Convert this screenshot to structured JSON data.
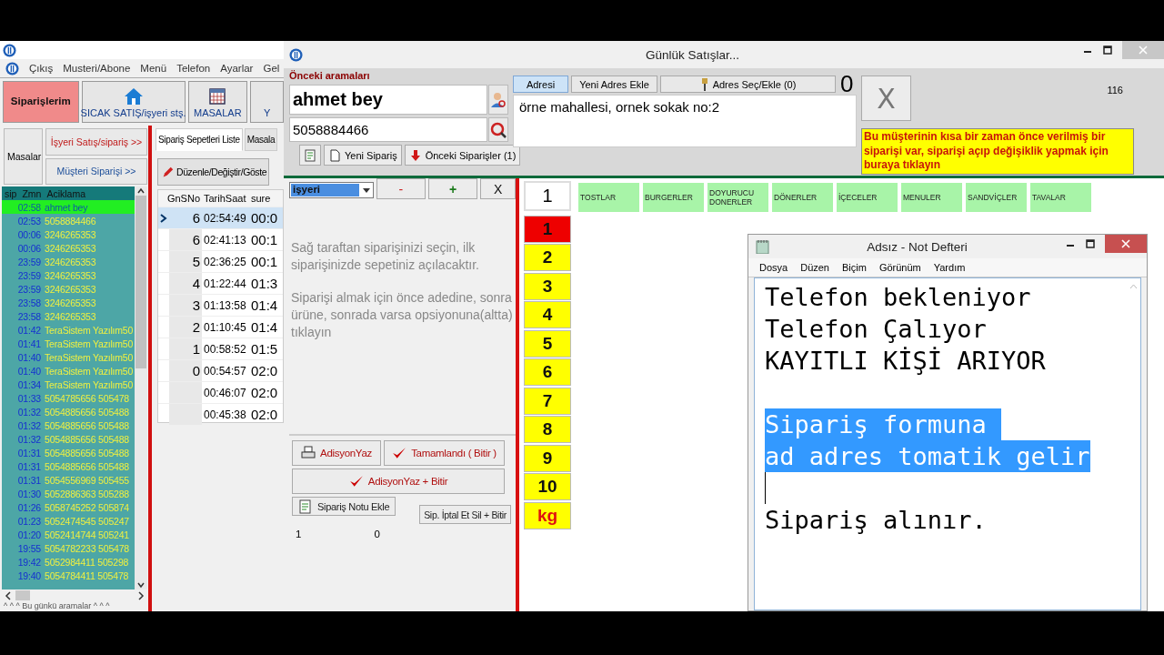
{
  "main_window": {
    "menu": [
      "Çıkış",
      "Musteri/Abone",
      "Menü",
      "Telefon",
      "Ayarlar",
      "Gel"
    ],
    "toolbar": [
      {
        "label": "Siparişlerim",
        "selected": true
      },
      {
        "label": "SICAK SATIŞ/işyeri stş.",
        "selected": false
      },
      {
        "label": "MASALAR",
        "selected": false
      },
      {
        "label": "Y",
        "selected": false
      }
    ],
    "side_buttons": [
      "Masalar",
      "İşyeri Satış/sipariş >>",
      "Müşteri Siparişi >>"
    ],
    "calls": {
      "columns": [
        "sip",
        "Zmn",
        "Aciklama"
      ],
      "rows": [
        {
          "time": "02:58",
          "description": "ahmet bey",
          "selected": true
        },
        {
          "time": "02:53",
          "description": "5058884466",
          "selected": false
        },
        {
          "time": "00:06",
          "description": "3246265353",
          "selected": false
        },
        {
          "time": "00:06",
          "description": "3246265353",
          "selected": false
        },
        {
          "time": "23:59",
          "description": "3246265353",
          "selected": false
        },
        {
          "time": "23:59",
          "description": "3246265353",
          "selected": false
        },
        {
          "time": "23:59",
          "description": "3246265353",
          "selected": false
        },
        {
          "time": "23:58",
          "description": "3246265353",
          "selected": false
        },
        {
          "time": "23:58",
          "description": "3246265353",
          "selected": false
        },
        {
          "time": "01:42",
          "description": "TeraSistem Yazılım50",
          "selected": false
        },
        {
          "time": "01:41",
          "description": "TeraSistem Yazılım50",
          "selected": false
        },
        {
          "time": "01:40",
          "description": "TeraSistem Yazılım50",
          "selected": false
        },
        {
          "time": "01:40",
          "description": "TeraSistem Yazılım50",
          "selected": false
        },
        {
          "time": "01:34",
          "description": "TeraSistem Yazılım50",
          "selected": false
        },
        {
          "time": "01:33",
          "description": "5054785656 505478",
          "selected": false
        },
        {
          "time": "01:32",
          "description": "5054885656 505488",
          "selected": false
        },
        {
          "time": "01:32",
          "description": "5054885656 505488",
          "selected": false
        },
        {
          "time": "01:32",
          "description": "5054885656 505488",
          "selected": false
        },
        {
          "time": "01:31",
          "description": "5054885656 505488",
          "selected": false
        },
        {
          "time": "01:31",
          "description": "5054885656 505488",
          "selected": false
        },
        {
          "time": "01:31",
          "description": "5054556969 505455",
          "selected": false
        },
        {
          "time": "01:30",
          "description": "5052886363 505288",
          "selected": false
        },
        {
          "time": "01:26",
          "description": "5058745252 505874",
          "selected": false
        },
        {
          "time": "01:23",
          "description": "5052474545 505247",
          "selected": false
        },
        {
          "time": "01:20",
          "description": "5052414744 505241",
          "selected": false
        },
        {
          "time": "19:55",
          "description": "5054782233 505478",
          "selected": false
        },
        {
          "time": "19:42",
          "description": "5052984411 505298",
          "selected": false
        },
        {
          "time": "19:40",
          "description": "5054784411 505478",
          "selected": false
        }
      ],
      "footer": "^ ^ ^ Bu günkü aramalar ^ ^ ^"
    },
    "tabs": [
      {
        "label": "Sipariş Sepetleri Liste",
        "selected": true
      },
      {
        "label": "Masala",
        "selected": false
      }
    ],
    "edit_button": "Düzenle/Değiştir/Göste",
    "orders": {
      "columns": [
        "GnSNo",
        "TarihSaat",
        "sure"
      ],
      "rows": [
        {
          "no": "6",
          "time": "02:54:49",
          "duration": "00:0",
          "selected": true
        },
        {
          "no": "6",
          "time": "02:41:13",
          "duration": "00:1",
          "selected": false
        },
        {
          "no": "5",
          "time": "02:36:25",
          "duration": "00:1",
          "selected": false
        },
        {
          "no": "4",
          "time": "01:22:44",
          "duration": "01:3",
          "selected": false
        },
        {
          "no": "3",
          "time": "01:13:58",
          "duration": "01:4",
          "selected": false
        },
        {
          "no": "2",
          "time": "01:10:45",
          "duration": "01:4",
          "selected": false
        },
        {
          "no": "1",
          "time": "00:58:52",
          "duration": "01:5",
          "selected": false
        },
        {
          "no": "0",
          "time": "00:54:57",
          "duration": "02:0",
          "selected": false
        },
        {
          "time": "00:46:07",
          "duration": "02:0",
          "selected": false
        },
        {
          "time": "00:45:38",
          "duration": "02:0",
          "selected": false
        }
      ]
    }
  },
  "sales_window": {
    "title": "Günlük Satışlar...",
    "previous_calls_label": "Önceki aramaları",
    "customer_name": "ahmet bey",
    "phone": "5058884466",
    "order_buttons": [
      "Yeni Sipariş",
      "Önceki Siparişler (1)"
    ],
    "address_tabs": [
      {
        "label": "Adresi",
        "selected": true
      },
      {
        "label": "Yeni Adres Ekle",
        "selected": false
      },
      {
        "label": "Adres Seç/Ekle (0)",
        "selected": false
      }
    ],
    "counter": "0",
    "address": "örne mahallesi, ornek sokak no:2",
    "close_button": "X",
    "number": "116",
    "warning": "Bu müşterinin kısa bir zaman önce verilmiş bir siparişi var, siparişi açıp değişiklik yapmak için buraya tıklayın",
    "order_type": "işyeri",
    "step_buttons": [
      "-",
      "+",
      "X"
    ],
    "instructions": [
      "Sağ taraftan siparişinizi seçin, ilk siparişinizde sepetiniz açılacaktır.",
      "Siparişi almak için önce adedine, sonra ürüne, sonrada varsa opsiyonuna(altta) tıklayın"
    ],
    "actions": {
      "print": "AdisyonYaz",
      "complete": "Tamamlandı ( Bitir )",
      "print_complete": "AdisyonYaz + Bitir",
      "note": "Sipariş Notu Ekle",
      "cancel": "Sip. İptal Et Sil + Bitir"
    },
    "totals": [
      "1",
      "0"
    ],
    "quantity_display": "1",
    "quantities": [
      {
        "label": "1",
        "selected": true
      },
      {
        "label": "2",
        "selected": false
      },
      {
        "label": "3",
        "selected": false
      },
      {
        "label": "4",
        "selected": false
      },
      {
        "label": "5",
        "selected": false
      },
      {
        "label": "6",
        "selected": false
      },
      {
        "label": "7",
        "selected": false
      },
      {
        "label": "8",
        "selected": false
      },
      {
        "label": "9",
        "selected": false
      },
      {
        "label": "10",
        "selected": false
      },
      {
        "label": "kg",
        "selected": false
      }
    ],
    "categories": [
      "TOSTLAR",
      "BURGERLER",
      "DOYURUCU DONERLER",
      "DÖNERLER",
      "İÇECELER",
      "MENULER",
      "SANDVİÇLER",
      "TAVALAR"
    ]
  },
  "notepad": {
    "title": "Adsız - Not Defteri",
    "menu": [
      "Dosya",
      "Düzen",
      "Biçim",
      "Görünüm",
      "Yardım"
    ],
    "paragraphs": [
      {
        "lines": [
          {
            "text": "Telefon bekleniyor",
            "selected": false
          },
          {
            "text": "Telefon Çalıyor",
            "selected": false
          },
          {
            "text": "KAYITLI KİŞİ ARIYOR",
            "selected": false
          }
        ]
      },
      {
        "lines": [
          {
            "text": "Sipariş formuna ",
            "selected": true
          },
          {
            "text": "ad adres tomatik gelir",
            "selected": true
          }
        ]
      },
      {
        "lines": [
          {
            "text": "Sipariş alınır.",
            "selected": false
          }
        ]
      }
    ]
  }
}
